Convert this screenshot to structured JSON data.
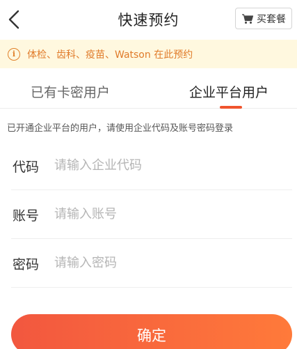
{
  "header": {
    "title": "快速预约",
    "back_icon": "chevron-left-icon",
    "buy_button": {
      "icon": "cart-icon",
      "label": "买套餐"
    }
  },
  "notice": {
    "icon": "info-circle-icon",
    "text": "体检、齿科、疫苗、Watson 在此预约",
    "color": "#e07b2a"
  },
  "tabs": [
    {
      "label": "已有卡密用户",
      "active": false
    },
    {
      "label": "企业平台用户",
      "active": true
    }
  ],
  "hint": "已开通企业平台的用户，请使用企业代码及账号密码登录",
  "form": {
    "fields": [
      {
        "label": "代码",
        "placeholder": "请输入企业代码",
        "value": ""
      },
      {
        "label": "账号",
        "placeholder": "请输入账号",
        "value": ""
      },
      {
        "label": "密码",
        "placeholder": "请输入密码",
        "value": ""
      }
    ],
    "submit_label": "确定"
  },
  "colors": {
    "accent": "#f0542e",
    "notice_bg": "#fff8df"
  }
}
